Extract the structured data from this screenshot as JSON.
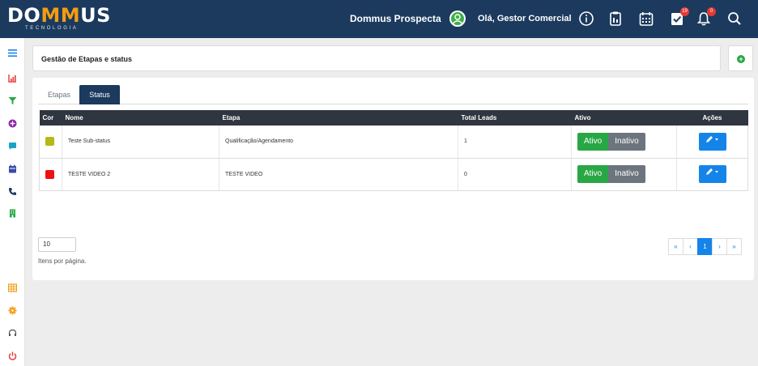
{
  "brand": {
    "logo_prefix": "DO",
    "logo_accent": "MM",
    "logo_suffix": "US",
    "logo_sub": "TECNOLOGIA",
    "accent_color": "#f39c12",
    "navy": "#1b3a5e"
  },
  "topbar": {
    "app_title": "Dommus Prospecta",
    "greeting": "Olá, Gestor Comercial",
    "icons": [
      "user-circle-icon",
      "info-icon",
      "clipboard-icon",
      "calendar-icon",
      "task-check-icon",
      "bell-icon",
      "search-icon"
    ],
    "task_badge": "19",
    "bell_badge": "0"
  },
  "sidebar": {
    "icons": [
      "menu-icon",
      "chart-icon",
      "filter-icon",
      "plus-circle-icon",
      "chat-icon",
      "calendar-icon",
      "phone-icon",
      "building-icon",
      "grid-icon",
      "gear-icon",
      "headset-icon",
      "power-icon"
    ]
  },
  "page": {
    "title": "Gestão de Etapas e status",
    "add_button": "+"
  },
  "tabs": [
    {
      "label": "Etapas"
    },
    {
      "label": "Status"
    }
  ],
  "table": {
    "headers": {
      "cor": "Cor",
      "nome": "Nome",
      "etapa": "Etapa",
      "total": "Total Leads",
      "ativo": "Ativo",
      "acoes": "Ações"
    },
    "rows": [
      {
        "color": "#b5b81a",
        "nome": "Teste Sub-status",
        "etapa": "Qualificação/Agendamento",
        "total": "1",
        "on": "Ativo",
        "off": "Inativo"
      },
      {
        "color": "#ee1111",
        "nome": "TESTE VIDEO 2",
        "etapa": "TESTE VIDEO",
        "total": "0",
        "on": "Ativo",
        "off": "Inativo"
      }
    ]
  },
  "pagination": {
    "per_page": "10",
    "per_page_label": "Itens por página.",
    "first": "«",
    "prev": "‹",
    "current": "1",
    "next": "›",
    "last": "»"
  }
}
